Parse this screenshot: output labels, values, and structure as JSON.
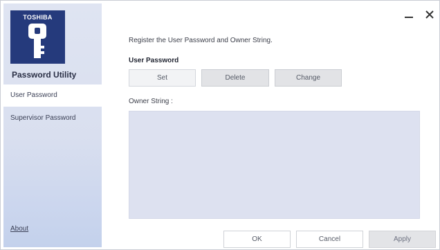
{
  "sidebar": {
    "logo_brand": "TOSHIBA",
    "app_title": "Password Utility",
    "items": [
      {
        "label": "User Password",
        "active": true
      },
      {
        "label": "Supervisor Password",
        "active": false
      }
    ],
    "about_label": "About"
  },
  "window_controls": {
    "minimize_icon": "minimize-icon",
    "close_icon": "close-icon"
  },
  "main": {
    "instruction": "Register the User Password and Owner String.",
    "section_title": "User Password",
    "buttons": {
      "set": "Set",
      "delete": "Delete",
      "change": "Change"
    },
    "owner_string_label": "Owner String :",
    "owner_string_value": ""
  },
  "footer": {
    "ok": "OK",
    "cancel": "Cancel",
    "apply": "Apply"
  }
}
